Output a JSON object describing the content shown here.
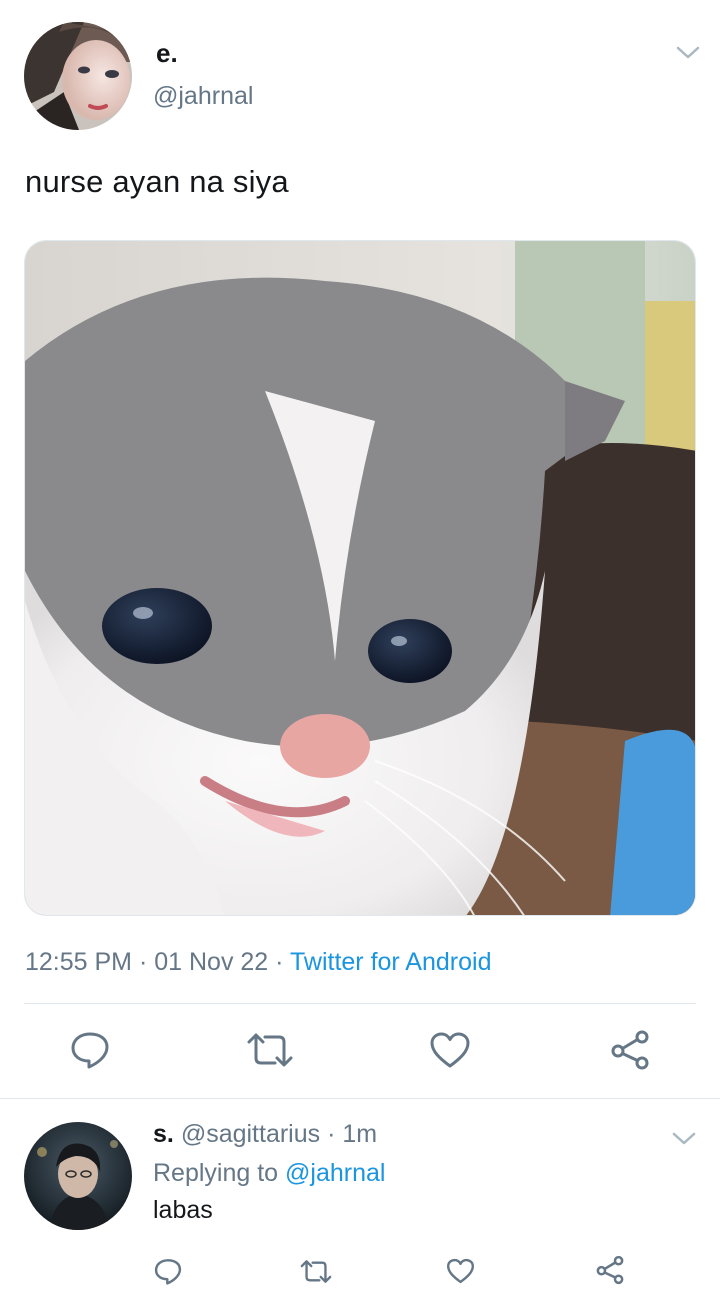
{
  "tweet": {
    "author": {
      "name": "e.",
      "handle": "@jahrnal",
      "avatar": "profile-photo"
    },
    "text": "nurse ayan na siya",
    "media": "kitten-photo",
    "time": "12:55 PM",
    "separator": "·",
    "date": "01 Nov 22",
    "source": "Twitter for Android",
    "icons": {
      "menu": "chevron-down-icon",
      "reply": "reply-icon",
      "retweet": "retweet-icon",
      "like": "heart-icon",
      "share": "share-icon"
    }
  },
  "reply": {
    "author": {
      "name": "s.",
      "handle": "@sagittarius",
      "separator": "·",
      "time": "1m",
      "avatar": "profile-photo"
    },
    "replying_label": "Replying to",
    "replying_to": "@jahrnal",
    "text": "labas"
  },
  "colors": {
    "text": "#14171a",
    "muted": "#657786",
    "link": "#1b95e0",
    "divider": "#e1e8ed"
  }
}
